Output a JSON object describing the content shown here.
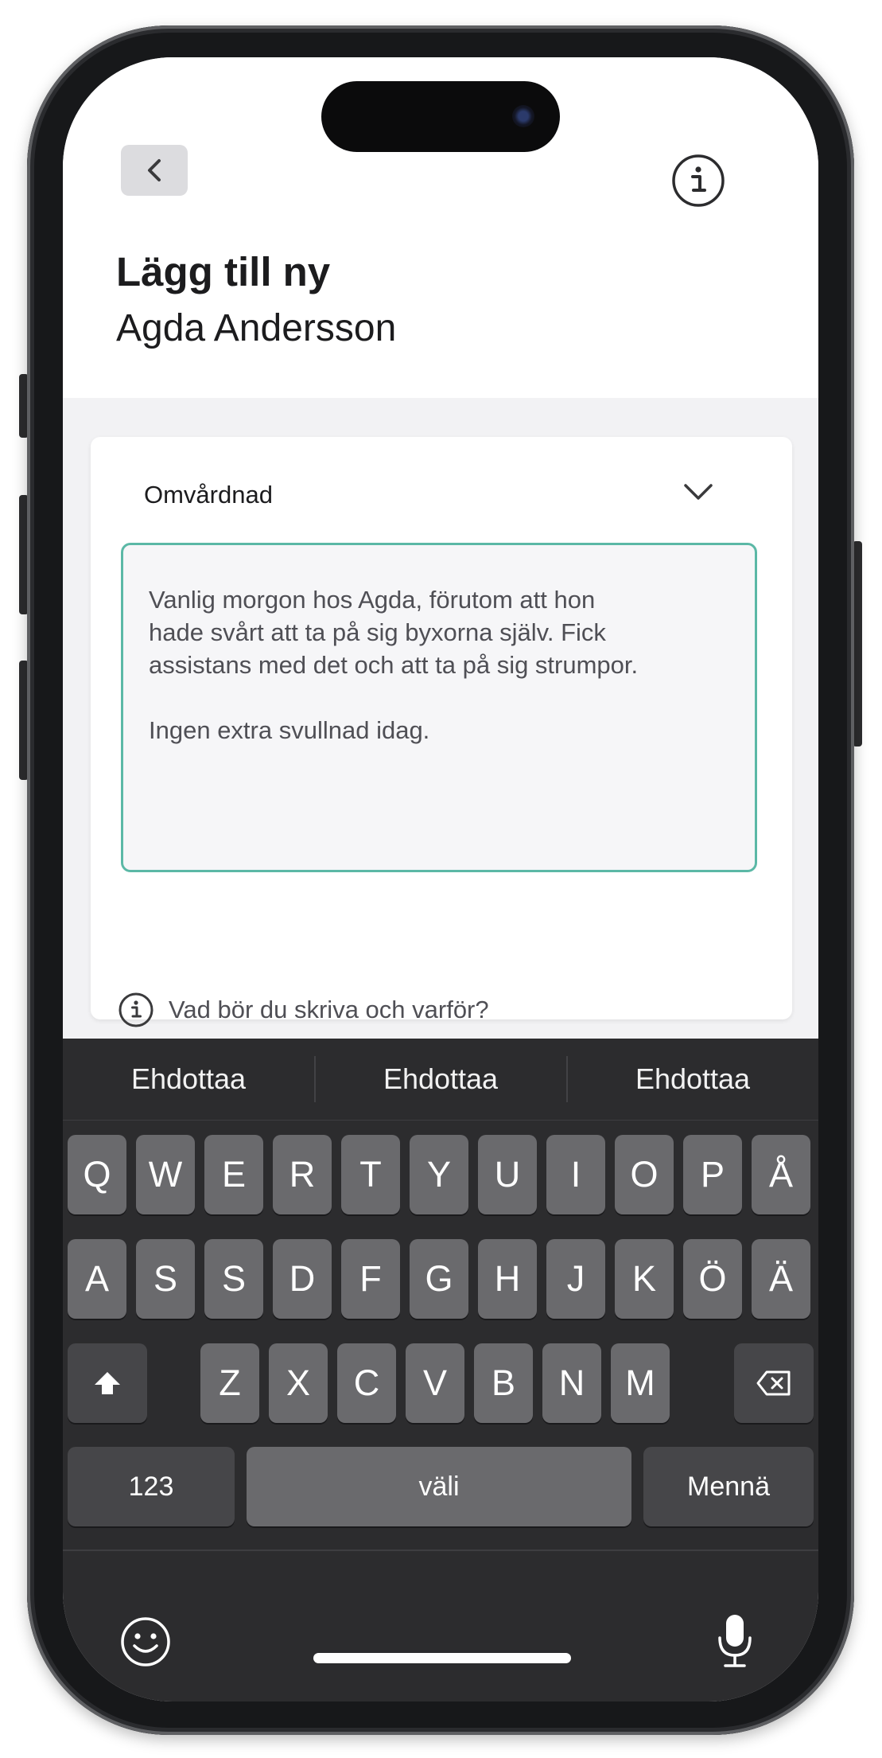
{
  "header": {
    "back_icon": "chevron-left-icon",
    "info_icon": "info-icon",
    "title": "Lägg till ny",
    "subtitle": "Agda Andersson"
  },
  "card": {
    "category": "Omvårdnad",
    "dropdown_icon": "chevron-down-icon",
    "note_text": "Vanlig morgon hos Agda, förutom att hon\nhade svårt att ta på sig byxorna själv. Fick\nassistans med det och att ta på sig strumpor.\n\nIngen extra svullnad idag.",
    "help_link": "Vad bör du skriva och varför?",
    "accent_color": "#5bb8a6"
  },
  "keyboard": {
    "suggestions": [
      "Ehdottaa",
      "Ehdottaa",
      "Ehdottaa"
    ],
    "row1": [
      "Q",
      "W",
      "E",
      "R",
      "T",
      "Y",
      "U",
      "I",
      "O",
      "P",
      "Å"
    ],
    "row2": [
      "A",
      "S",
      "S",
      "D",
      "F",
      "G",
      "H",
      "J",
      "K",
      "Ö",
      "Ä"
    ],
    "row3": [
      "Z",
      "X",
      "C",
      "V",
      "B",
      "N",
      "M"
    ],
    "shift_icon": "shift-icon",
    "backspace_icon": "backspace-icon",
    "numbers_label": "123",
    "space_label": "väli",
    "return_label": "Mennä",
    "emoji_icon": "emoji-icon",
    "mic_icon": "microphone-icon"
  }
}
